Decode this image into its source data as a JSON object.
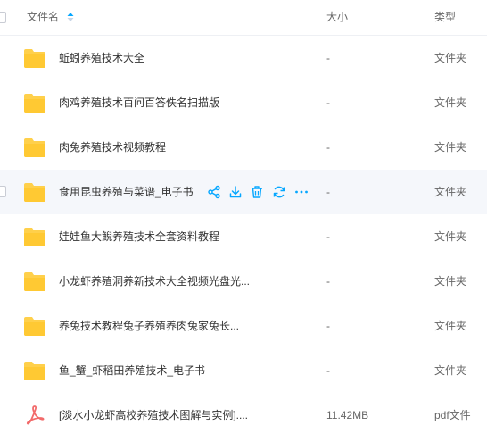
{
  "header": {
    "name_label": "文件名",
    "size_label": "大小",
    "type_label": "类型"
  },
  "colors": {
    "accent": "#06a7ff",
    "folder": "#ffd04b",
    "folder_tab": "#f5b934",
    "pdf": "#f26b6b",
    "hover_row": "#f5f7fb"
  },
  "rows": [
    {
      "icon": "folder-icon",
      "name": "蚯蚓养殖技术大全",
      "size": "-",
      "type": "文件夹"
    },
    {
      "icon": "folder-icon",
      "name": "肉鸡养殖技术百问百答佚名扫描版",
      "size": "-",
      "type": "文件夹"
    },
    {
      "icon": "folder-icon",
      "name": "肉兔养殖技术视频教程",
      "size": "-",
      "type": "文件夹"
    },
    {
      "icon": "folder-icon",
      "name": "食用昆虫养殖与菜谱_电子书",
      "size": "-",
      "type": "文件夹",
      "hovered": true
    },
    {
      "icon": "folder-icon",
      "name": "娃娃鱼大鲵养殖技术全套资料教程",
      "size": "-",
      "type": "文件夹"
    },
    {
      "icon": "folder-icon",
      "name": "小龙虾养殖洞养新技术大全视频光盘光...",
      "size": "-",
      "type": "文件夹"
    },
    {
      "icon": "folder-icon",
      "name": "养兔技术教程兔子养殖养肉兔家兔长...",
      "size": "-",
      "type": "文件夹"
    },
    {
      "icon": "folder-icon",
      "name": "鱼_蟹_虾稻田养殖技术_电子书",
      "size": "-",
      "type": "文件夹"
    },
    {
      "icon": "pdf-icon",
      "name": "[淡水小龙虾高校养殖技术图解与实例]....",
      "size": "11.42MB",
      "type": "pdf文件"
    }
  ],
  "row_actions": [
    {
      "name": "share-icon"
    },
    {
      "name": "download-icon"
    },
    {
      "name": "delete-icon"
    },
    {
      "name": "transfer-icon"
    },
    {
      "name": "more-icon"
    }
  ]
}
